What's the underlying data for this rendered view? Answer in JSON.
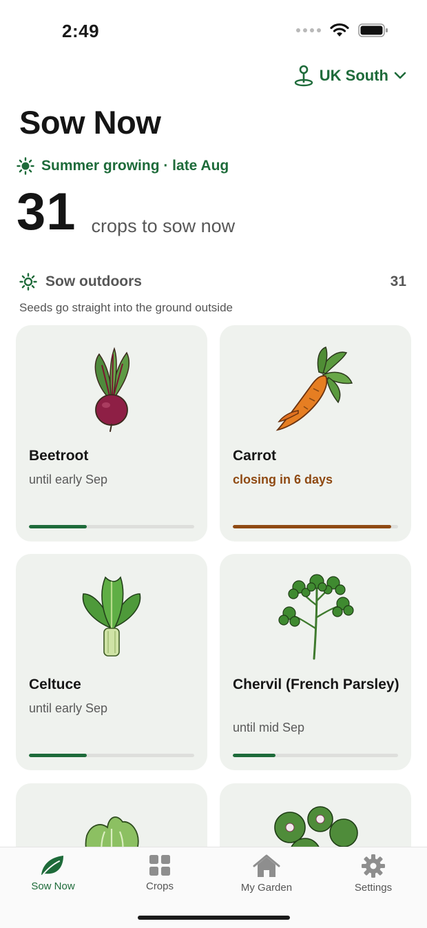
{
  "status_bar": {
    "time": "2:49"
  },
  "region": {
    "label": "UK South"
  },
  "page_title": "Sow Now",
  "season": {
    "label": "Summer growing · late Aug"
  },
  "summary": {
    "count": "31",
    "text": "crops to sow now"
  },
  "section": {
    "title": "Sow outdoors",
    "count": "31",
    "subtitle": "Seeds go straight into the ground outside"
  },
  "crops": [
    {
      "name": "Beetroot",
      "status": "until early Sep",
      "progress": 0.35,
      "closing": false,
      "icon": "beetroot-icon"
    },
    {
      "name": "Carrot",
      "status": "closing in 6 days",
      "progress": 0.96,
      "closing": true,
      "icon": "carrot-icon"
    },
    {
      "name": "Celtuce",
      "status": "until early Sep",
      "progress": 0.35,
      "closing": false,
      "icon": "celtuce-icon"
    },
    {
      "name": "Chervil (French Parsley)",
      "status": "until mid Sep",
      "progress": 0.26,
      "closing": false,
      "icon": "chervil-icon"
    },
    {
      "name": "",
      "status": "",
      "progress": 0,
      "closing": false,
      "icon": "lettuce-icon"
    },
    {
      "name": "",
      "status": "",
      "progress": 0,
      "closing": false,
      "icon": "claytonia-icon"
    }
  ],
  "tabs": [
    {
      "label": "Sow Now",
      "icon": "leaf-icon",
      "active": true
    },
    {
      "label": "Crops",
      "icon": "grid-icon",
      "active": false
    },
    {
      "label": "My Garden",
      "icon": "house-icon",
      "active": false
    },
    {
      "label": "Settings",
      "icon": "gear-icon",
      "active": false
    }
  ],
  "colors": {
    "accent": "#1e6b3a",
    "warning": "#8f4a13",
    "card_bg": "#eff2ee"
  }
}
